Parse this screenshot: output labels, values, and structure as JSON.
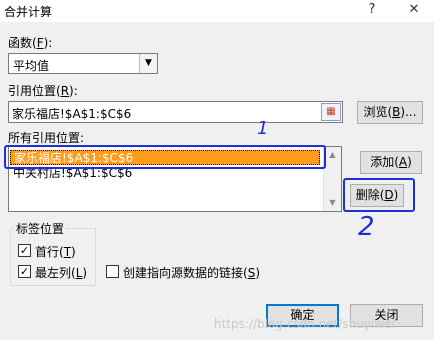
{
  "window": {
    "title": "合并计算",
    "help_glyph": "?",
    "close_glyph": "✕"
  },
  "function": {
    "label_text": "函数(",
    "label_key": "F",
    "label_end": "):",
    "selected": "平均值"
  },
  "reference": {
    "label_text": "引用位置(",
    "label_key": "R",
    "label_end": "):",
    "value": "家乐福店!$A$1:$C$6",
    "browse_text": "浏览(",
    "browse_key": "B",
    "browse_end": ")..."
  },
  "all_references": {
    "label": "所有引用位置:",
    "items": [
      "家乐福店!$A$1:$C$6",
      "中关村店!$A$1:$C$6"
    ],
    "selected_index": 0
  },
  "buttons": {
    "add_text": "添加(",
    "add_key": "A",
    "add_end": ")",
    "delete_text": "删除(",
    "delete_key": "D",
    "delete_end": ")",
    "ok": "确定",
    "close": "关闭"
  },
  "label_position": {
    "title": "标签位置",
    "top_row_text": "首行(",
    "top_row_key": "T",
    "top_row_end": ")",
    "top_row_checked": true,
    "left_col_text": "最左列(",
    "left_col_key": "L",
    "left_col_end": ")",
    "left_col_checked": true,
    "link_text": "创建指向源数据的链接(",
    "link_key": "S",
    "link_end": ")",
    "link_checked": false
  },
  "annotations": {
    "mark_1": "1",
    "mark_2": "2",
    "color": "#1c2fd8"
  },
  "watermark": "https://blog.csdn.net/shuyiwei"
}
